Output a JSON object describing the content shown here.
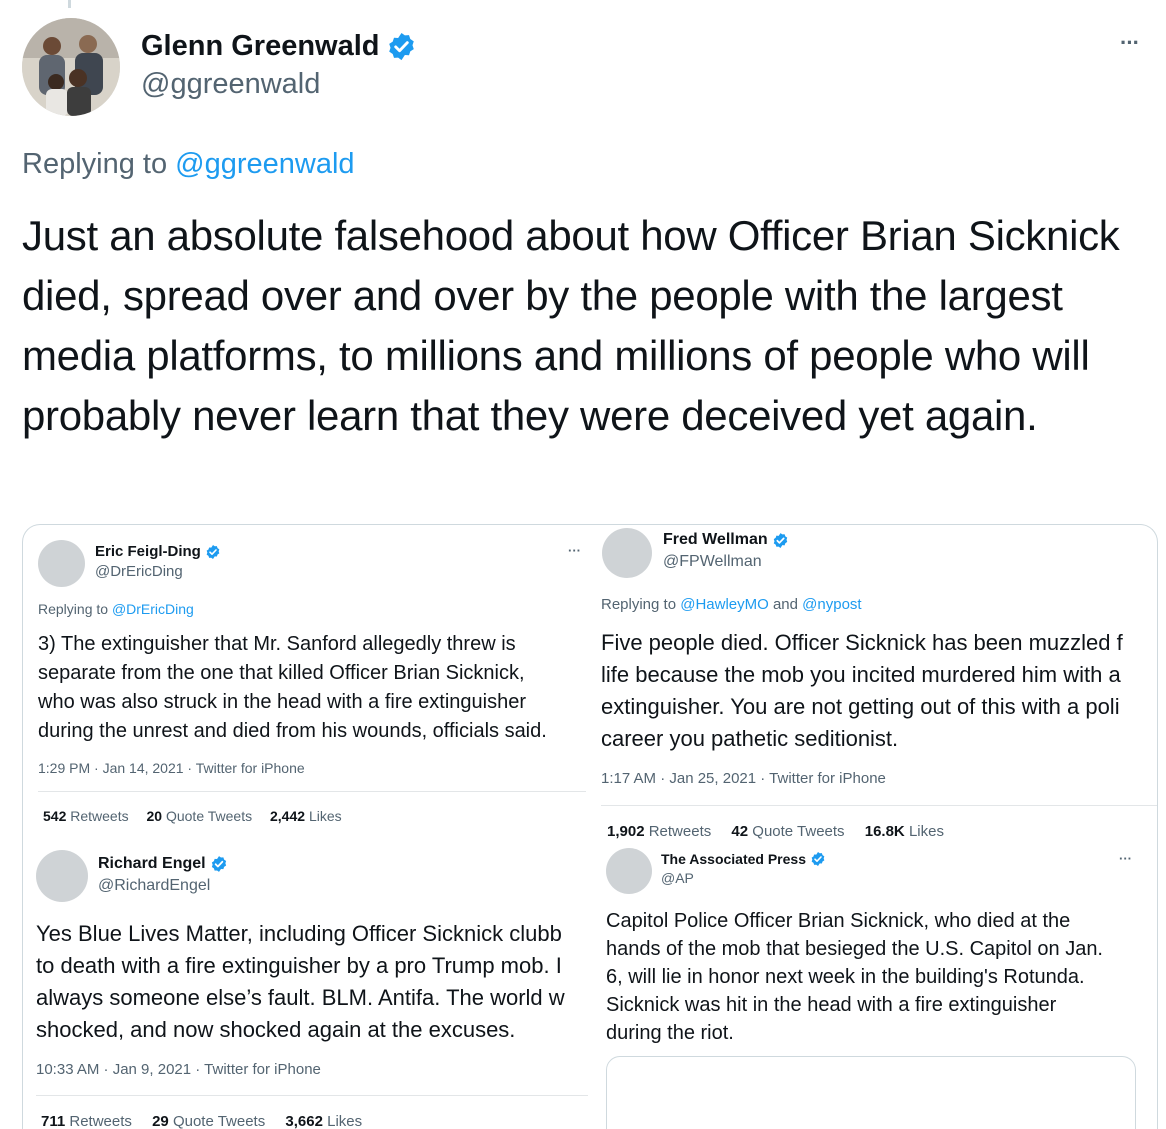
{
  "main_tweet": {
    "name": "Glenn Greenwald",
    "handle": "@ggreenwald",
    "replying_prefix": "Replying to",
    "replying_to": "@ggreenwald",
    "text": "Just an absolute falsehood about how Officer Brian Sicknick died, spread over and over by the people with the largest media platforms, to millions and millions of people who will probably never learn that they were deceived yet again.",
    "more_label": "···"
  },
  "embedded": {
    "t1": {
      "name": "Eric Feigl-Ding",
      "handle": "@DrEricDing",
      "replying_prefix": "Replying to",
      "replying_to": "@DrEricDing",
      "lines": [
        "3) The extinguisher that Mr. Sanford allegedly threw is",
        "separate from the one that killed Officer Brian Sicknick,",
        "who was also struck in the head with a fire extinguisher",
        "during the unrest and died from his wounds, officials said."
      ],
      "meta": "1:29 PM · Jan 14, 2021 · Twitter for iPhone",
      "retweets": "542",
      "retweets_label": "Retweets",
      "quotes": "20",
      "quotes_label": "Quote Tweets",
      "likes": "2,442",
      "likes_label": "Likes",
      "more_label": "···"
    },
    "t2": {
      "name": "Fred Wellman",
      "handle": "@FPWellman",
      "replying_prefix": "Replying to",
      "replying_to_1": "@HawleyMO",
      "replying_and": "and",
      "replying_to_2": "@nypost",
      "lines": [
        "Five people died. Officer Sicknick has been muzzled f",
        "life because the mob you incited murdered him with a",
        "extinguisher. You are not getting out of this with a poli",
        "career you pathetic seditionist."
      ],
      "meta": "1:17 AM · Jan 25, 2021 · Twitter for iPhone",
      "retweets": "1,902",
      "retweets_label": "Retweets",
      "quotes": "42",
      "quotes_label": "Quote Tweets",
      "likes": "16.8K",
      "likes_label": "Likes"
    },
    "t3": {
      "name": "Richard Engel",
      "handle": "@RichardEngel",
      "lines": [
        "Yes Blue Lives Matter, including Officer Sicknick clubb",
        "to death with a fire extinguisher by a pro Trump mob. I",
        "always someone else’s fault. BLM. Antifa. The world w",
        "shocked, and now shocked again at the excuses."
      ],
      "meta": "10:33 AM · Jan 9, 2021 · Twitter for iPhone",
      "retweets": "711",
      "retweets_label": "Retweets",
      "quotes": "29",
      "quotes_label": "Quote Tweets",
      "likes": "3,662",
      "likes_label": "Likes"
    },
    "t4": {
      "name": "The Associated Press",
      "handle": "@AP",
      "lines": [
        "Capitol Police Officer Brian Sicknick, who died at the",
        "hands of the mob that besieged the U.S. Capitol on Jan.",
        "6, will lie in honor next week in the building's Rotunda.",
        "Sicknick was hit in the head with a fire extinguisher",
        "during the riot."
      ],
      "more_label": "···"
    }
  },
  "colors": {
    "link": "#1d9bf0",
    "verified": "#1d9bf0",
    "text": "#0f1419",
    "muted": "#536471"
  }
}
